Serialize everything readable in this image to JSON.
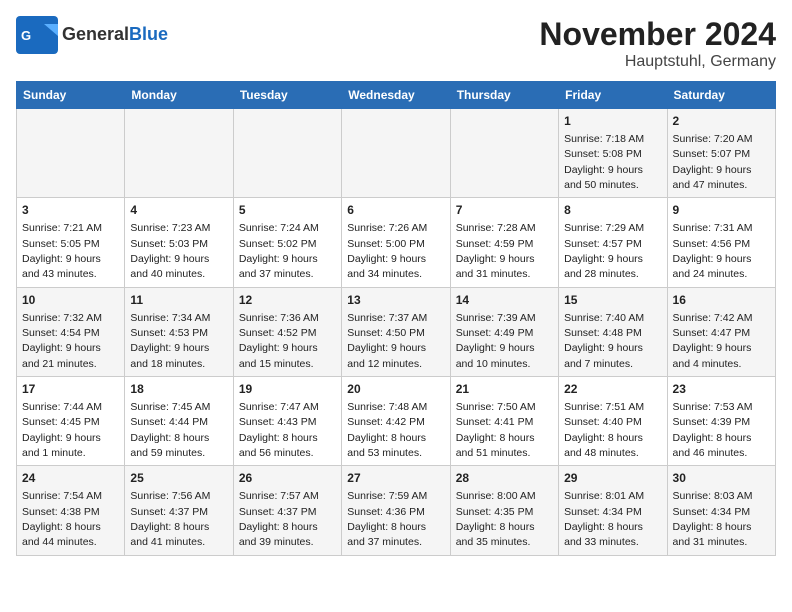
{
  "header": {
    "logo_general": "General",
    "logo_blue": "Blue",
    "title": "November 2024",
    "subtitle": "Hauptstuhl, Germany"
  },
  "columns": [
    "Sunday",
    "Monday",
    "Tuesday",
    "Wednesday",
    "Thursday",
    "Friday",
    "Saturday"
  ],
  "weeks": [
    {
      "days": [
        {
          "num": "",
          "info": ""
        },
        {
          "num": "",
          "info": ""
        },
        {
          "num": "",
          "info": ""
        },
        {
          "num": "",
          "info": ""
        },
        {
          "num": "",
          "info": ""
        },
        {
          "num": "1",
          "info": "Sunrise: 7:18 AM\nSunset: 5:08 PM\nDaylight: 9 hours and 50 minutes."
        },
        {
          "num": "2",
          "info": "Sunrise: 7:20 AM\nSunset: 5:07 PM\nDaylight: 9 hours and 47 minutes."
        }
      ]
    },
    {
      "days": [
        {
          "num": "3",
          "info": "Sunrise: 7:21 AM\nSunset: 5:05 PM\nDaylight: 9 hours and 43 minutes."
        },
        {
          "num": "4",
          "info": "Sunrise: 7:23 AM\nSunset: 5:03 PM\nDaylight: 9 hours and 40 minutes."
        },
        {
          "num": "5",
          "info": "Sunrise: 7:24 AM\nSunset: 5:02 PM\nDaylight: 9 hours and 37 minutes."
        },
        {
          "num": "6",
          "info": "Sunrise: 7:26 AM\nSunset: 5:00 PM\nDaylight: 9 hours and 34 minutes."
        },
        {
          "num": "7",
          "info": "Sunrise: 7:28 AM\nSunset: 4:59 PM\nDaylight: 9 hours and 31 minutes."
        },
        {
          "num": "8",
          "info": "Sunrise: 7:29 AM\nSunset: 4:57 PM\nDaylight: 9 hours and 28 minutes."
        },
        {
          "num": "9",
          "info": "Sunrise: 7:31 AM\nSunset: 4:56 PM\nDaylight: 9 hours and 24 minutes."
        }
      ]
    },
    {
      "days": [
        {
          "num": "10",
          "info": "Sunrise: 7:32 AM\nSunset: 4:54 PM\nDaylight: 9 hours and 21 minutes."
        },
        {
          "num": "11",
          "info": "Sunrise: 7:34 AM\nSunset: 4:53 PM\nDaylight: 9 hours and 18 minutes."
        },
        {
          "num": "12",
          "info": "Sunrise: 7:36 AM\nSunset: 4:52 PM\nDaylight: 9 hours and 15 minutes."
        },
        {
          "num": "13",
          "info": "Sunrise: 7:37 AM\nSunset: 4:50 PM\nDaylight: 9 hours and 12 minutes."
        },
        {
          "num": "14",
          "info": "Sunrise: 7:39 AM\nSunset: 4:49 PM\nDaylight: 9 hours and 10 minutes."
        },
        {
          "num": "15",
          "info": "Sunrise: 7:40 AM\nSunset: 4:48 PM\nDaylight: 9 hours and 7 minutes."
        },
        {
          "num": "16",
          "info": "Sunrise: 7:42 AM\nSunset: 4:47 PM\nDaylight: 9 hours and 4 minutes."
        }
      ]
    },
    {
      "days": [
        {
          "num": "17",
          "info": "Sunrise: 7:44 AM\nSunset: 4:45 PM\nDaylight: 9 hours and 1 minute."
        },
        {
          "num": "18",
          "info": "Sunrise: 7:45 AM\nSunset: 4:44 PM\nDaylight: 8 hours and 59 minutes."
        },
        {
          "num": "19",
          "info": "Sunrise: 7:47 AM\nSunset: 4:43 PM\nDaylight: 8 hours and 56 minutes."
        },
        {
          "num": "20",
          "info": "Sunrise: 7:48 AM\nSunset: 4:42 PM\nDaylight: 8 hours and 53 minutes."
        },
        {
          "num": "21",
          "info": "Sunrise: 7:50 AM\nSunset: 4:41 PM\nDaylight: 8 hours and 51 minutes."
        },
        {
          "num": "22",
          "info": "Sunrise: 7:51 AM\nSunset: 4:40 PM\nDaylight: 8 hours and 48 minutes."
        },
        {
          "num": "23",
          "info": "Sunrise: 7:53 AM\nSunset: 4:39 PM\nDaylight: 8 hours and 46 minutes."
        }
      ]
    },
    {
      "days": [
        {
          "num": "24",
          "info": "Sunrise: 7:54 AM\nSunset: 4:38 PM\nDaylight: 8 hours and 44 minutes."
        },
        {
          "num": "25",
          "info": "Sunrise: 7:56 AM\nSunset: 4:37 PM\nDaylight: 8 hours and 41 minutes."
        },
        {
          "num": "26",
          "info": "Sunrise: 7:57 AM\nSunset: 4:37 PM\nDaylight: 8 hours and 39 minutes."
        },
        {
          "num": "27",
          "info": "Sunrise: 7:59 AM\nSunset: 4:36 PM\nDaylight: 8 hours and 37 minutes."
        },
        {
          "num": "28",
          "info": "Sunrise: 8:00 AM\nSunset: 4:35 PM\nDaylight: 8 hours and 35 minutes."
        },
        {
          "num": "29",
          "info": "Sunrise: 8:01 AM\nSunset: 4:34 PM\nDaylight: 8 hours and 33 minutes."
        },
        {
          "num": "30",
          "info": "Sunrise: 8:03 AM\nSunset: 4:34 PM\nDaylight: 8 hours and 31 minutes."
        }
      ]
    }
  ]
}
